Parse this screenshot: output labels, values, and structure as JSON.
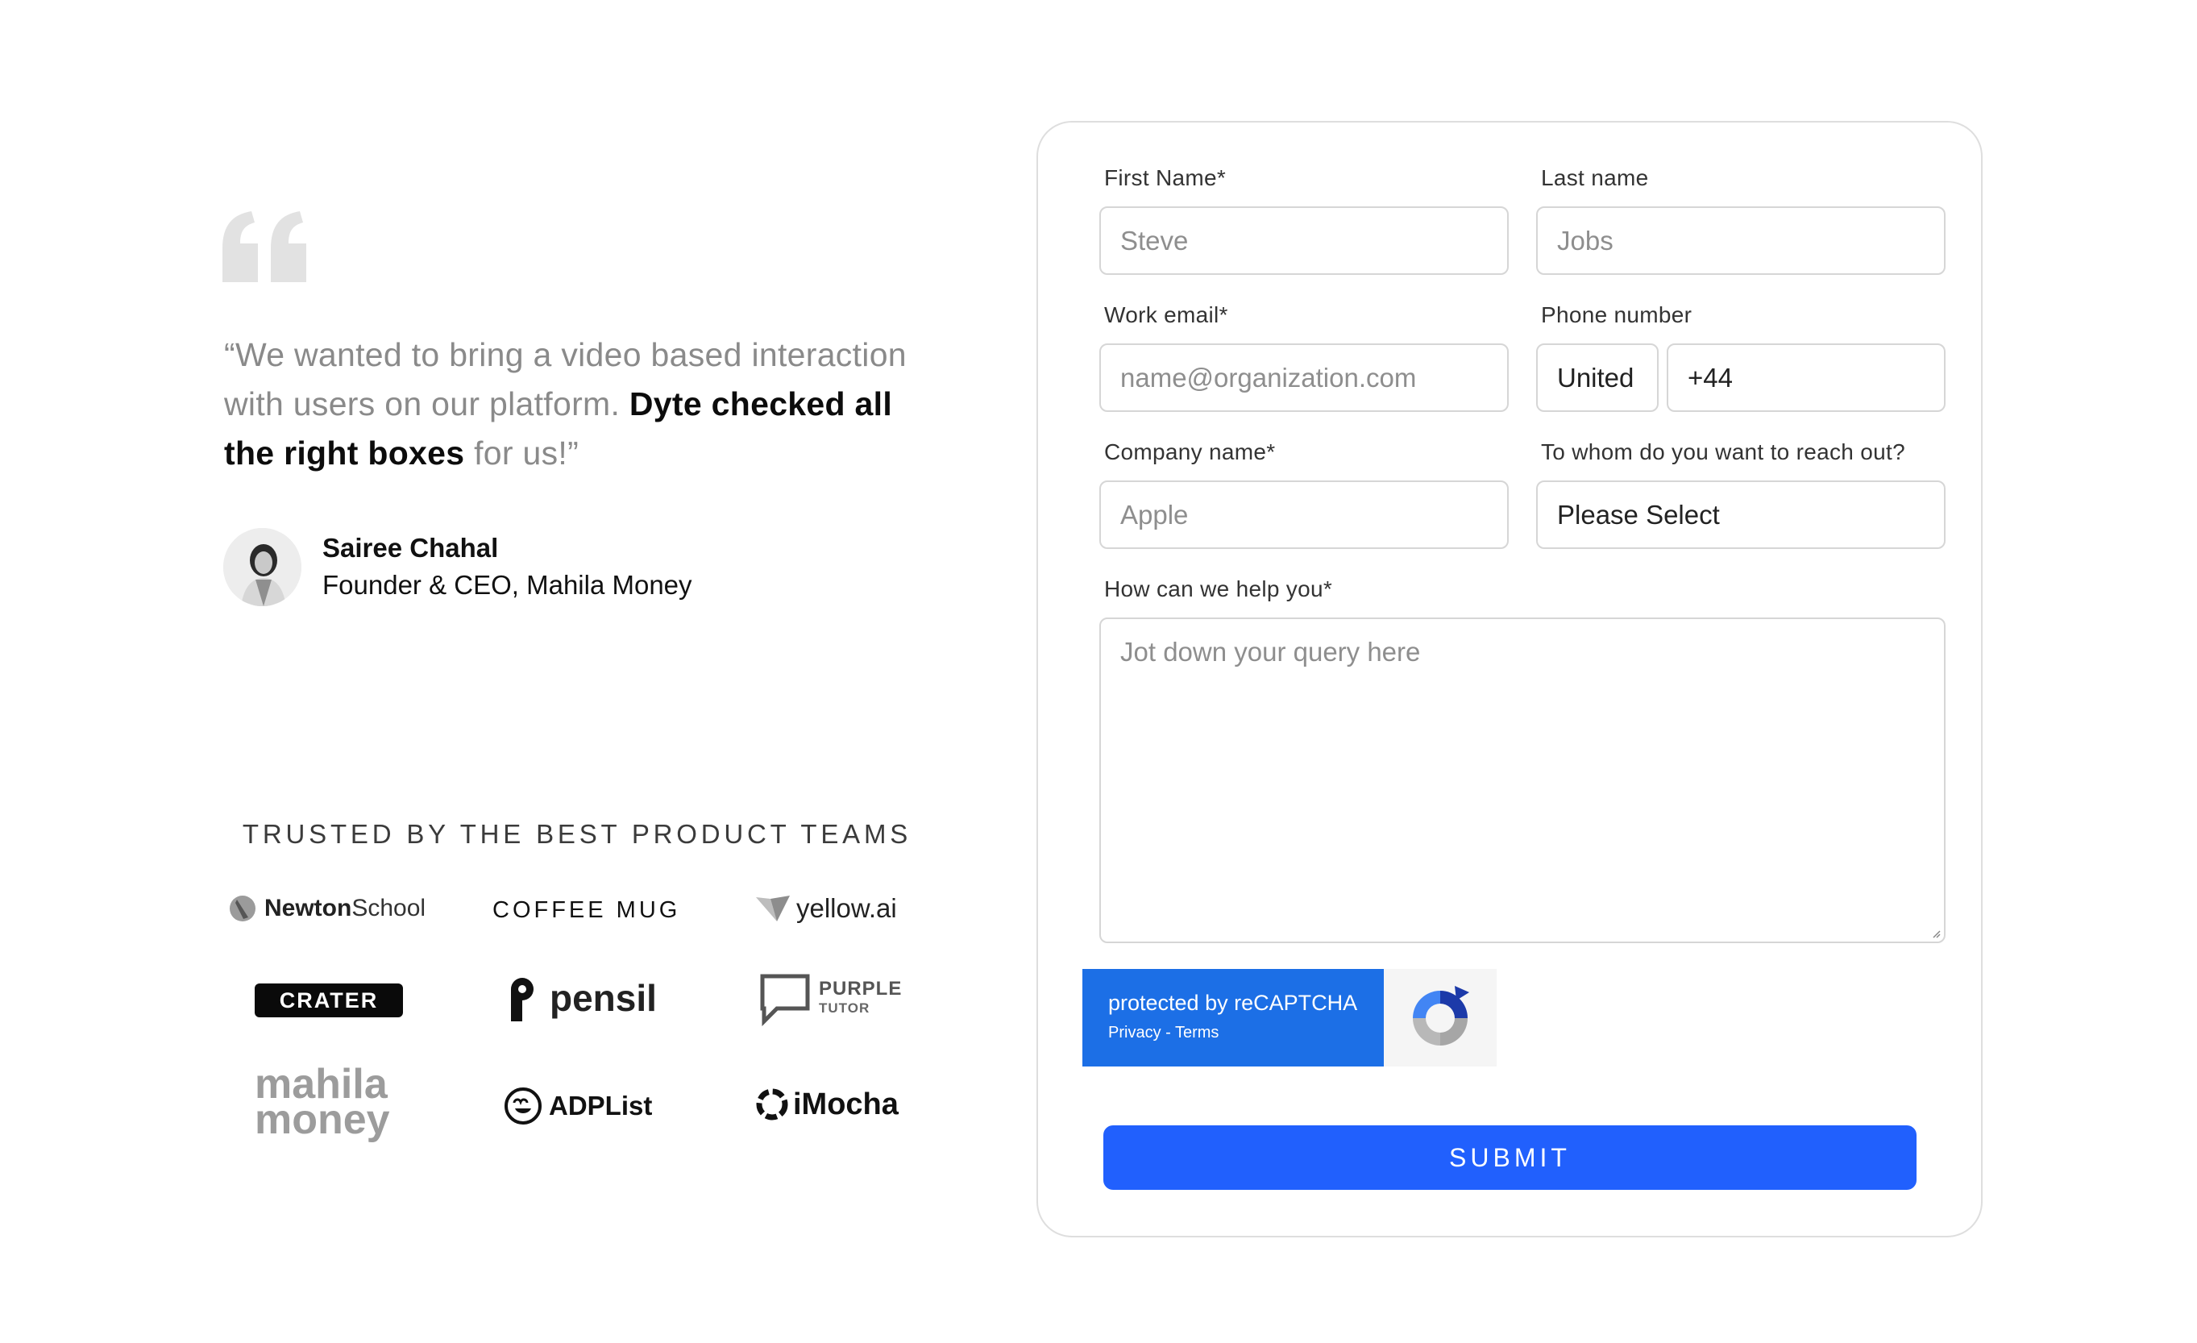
{
  "testimonial": {
    "quote_part1": "“We wanted to bring a video based interaction with users on our platform. ",
    "quote_strong": "Dyte checked all the right boxes",
    "quote_part3": " for us!”",
    "author_name": "Sairee Chahal",
    "author_role": "Founder & CEO, Mahila Money"
  },
  "trusted": {
    "heading": "TRUSTED BY THE BEST PRODUCT TEAMS",
    "logos": {
      "newton_bold": "Newton",
      "newton_light": " School",
      "coffee_mug": "COFFEE MUG",
      "yellow_ai": "yellow.ai",
      "crater": "CRATER",
      "pensil": "pensil",
      "purple_top": "PURPLE",
      "purple_bottom": "TUTOR",
      "mahila_top": "mahila",
      "mahila_bottom": "money",
      "adplist": "ADPList",
      "imocha": "iMocha"
    }
  },
  "form": {
    "first_name": {
      "label": "First Name*",
      "placeholder": "Steve"
    },
    "last_name": {
      "label": "Last name",
      "placeholder": "Jobs"
    },
    "work_email": {
      "label": "Work email*",
      "placeholder": "name@organization.com"
    },
    "phone": {
      "label": "Phone number",
      "country": "United",
      "code": "+44"
    },
    "company": {
      "label": "Company name*",
      "placeholder": "Apple"
    },
    "reach_out": {
      "label": "To whom do you want to reach out?",
      "value": "Please Select"
    },
    "help": {
      "label": "How can we help you*",
      "placeholder": "Jot down your query here"
    },
    "recaptcha": {
      "text": "protected by reCAPTCHA",
      "links": "Privacy - Terms"
    },
    "submit_label": "SUBMIT"
  },
  "colors": {
    "accent": "#2160fd",
    "recaptcha_blue": "#1c6fe6",
    "muted_text": "#8a8a8a",
    "border": "#d6d6d6"
  },
  "icons": [
    "quote-icon",
    "recaptcha-icon",
    "resize-handle-icon"
  ]
}
